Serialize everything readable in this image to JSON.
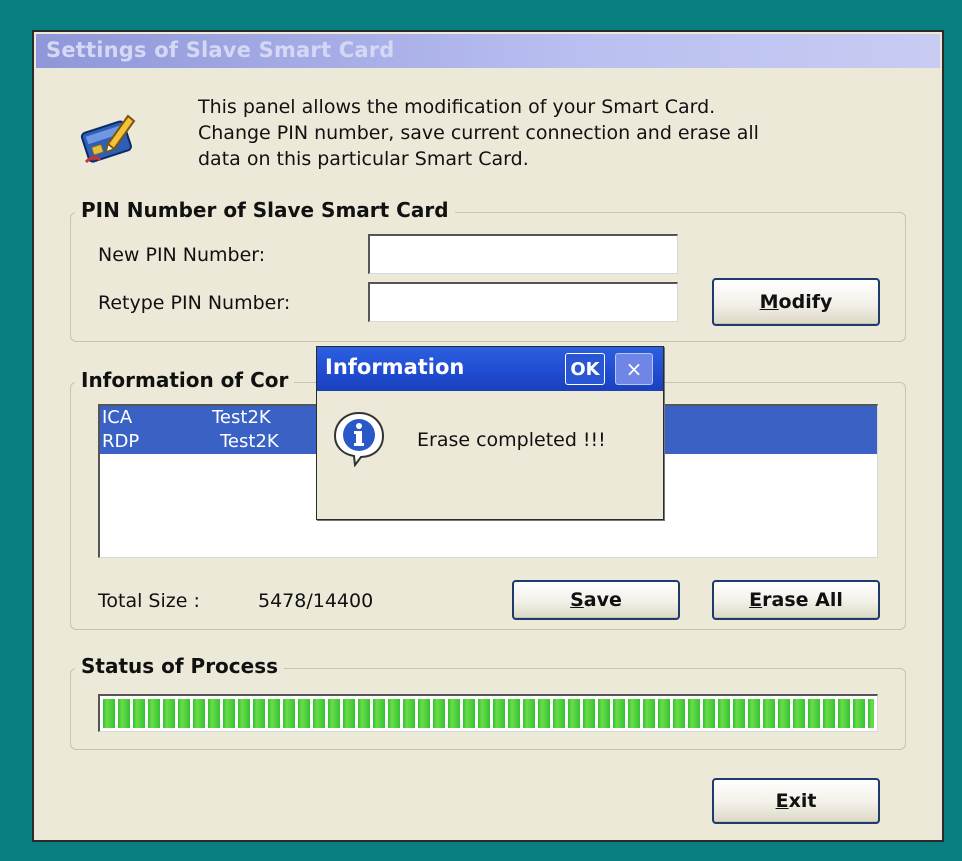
{
  "window": {
    "title": "Settings of Slave Smart Card",
    "intro_lines": [
      "This panel allows the modification of your Smart Card.",
      "Change PIN number, save current connection and erase all",
      "data on this particular Smart Card."
    ]
  },
  "pin_group": {
    "title": "PIN Number of Slave Smart Card",
    "new_pin_label": "New PIN Number:",
    "new_pin_value": "",
    "retype_pin_label": "Retype PIN Number:",
    "retype_pin_value": "",
    "modify_button_first": "M",
    "modify_button_rest": "odify"
  },
  "connections_group": {
    "title_visible": "Information of Cor",
    "rows": [
      {
        "protocol": "ICA",
        "server": "Test2K"
      },
      {
        "protocol": "RDP",
        "server": "Test2K"
      }
    ],
    "total_size_label": "Total Size :",
    "total_size_value": "5478/14400",
    "save_button_first": "S",
    "save_button_rest": "ave",
    "erase_button_first": "E",
    "erase_button_rest": "rase All"
  },
  "status_group": {
    "title": "Status of Process",
    "progress": 1.0
  },
  "exit_button_first": "E",
  "exit_button_rest": "xit",
  "dialog": {
    "title": "Information",
    "ok_label": "OK",
    "close_label": "×",
    "message": "Erase completed !!!",
    "icon": "info-icon"
  },
  "colors": {
    "desktop": "#0a7f82",
    "selection": "#3a62c4",
    "progress_green": "#33c233",
    "dialog_titlebar": "#1f4bd0"
  }
}
